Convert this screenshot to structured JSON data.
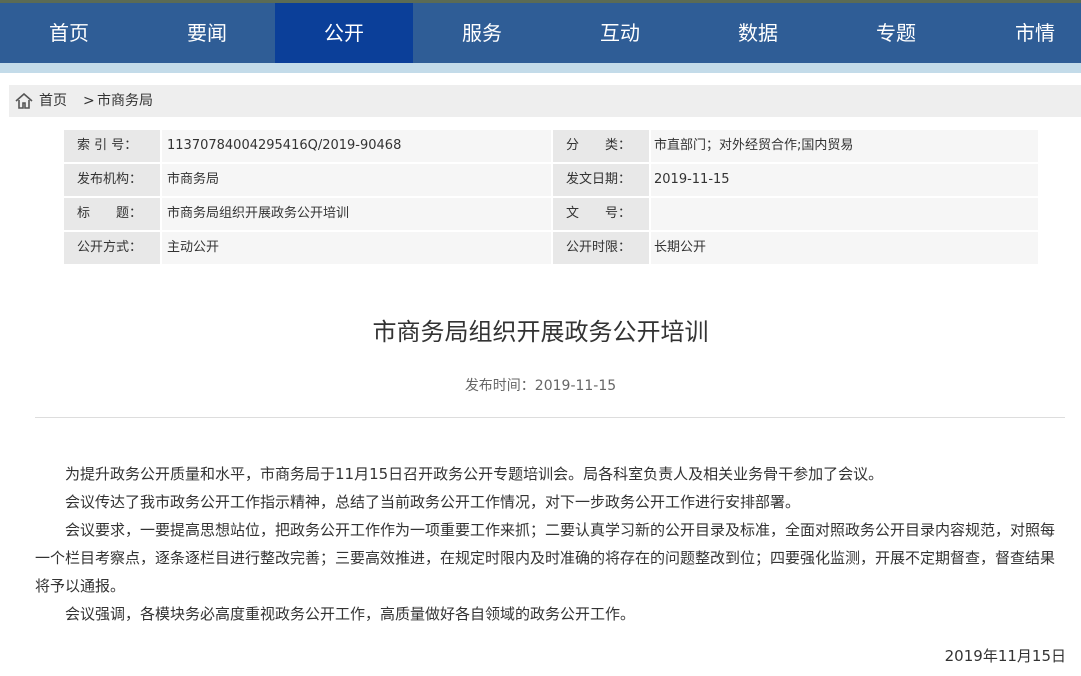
{
  "nav": {
    "items": [
      {
        "label": "首页"
      },
      {
        "label": "要闻"
      },
      {
        "label": "公开"
      },
      {
        "label": "服务"
      },
      {
        "label": "互动"
      },
      {
        "label": "数据"
      },
      {
        "label": "专题"
      },
      {
        "label": "市情"
      }
    ],
    "active": "公开"
  },
  "breadcrumb": {
    "home": "首页",
    "separator": ">",
    "current": "市商务局"
  },
  "meta": {
    "index_label": "索 引 号：",
    "index_value": "11370784004295416Q/2019-90468",
    "category_label": "分　　类：",
    "category_value": "市直部门；对外经贸合作;国内贸易",
    "org_label": "发布机构：",
    "org_value": "市商务局",
    "date_label": "发文日期：",
    "date_value": "2019-11-15",
    "title_label": "标　　题：",
    "title_value": "市商务局组织开展政务公开培训",
    "doc_label": "文　　号：",
    "doc_value": "",
    "mode_label": "公开方式：",
    "mode_value": "主动公开",
    "period_label": "公开时限：",
    "period_value": "长期公开"
  },
  "article": {
    "title": "市商务局组织开展政务公开培训",
    "pubtime": "发布时间：2019-11-15",
    "paragraphs": [
      "为提升政务公开质量和水平，市商务局于11月15日召开政务公开专题培训会。局各科室负责人及相关业务骨干参加了会议。",
      "会议传达了我市政务公开工作指示精神，总结了当前政务公开工作情况，对下一步政务公开工作进行安排部署。",
      "会议要求，一要提高思想站位，把政务公开工作作为一项重要工作来抓；二要认真学习新的公开目录及标准，全面对照政务公开目录内容规范，对照每一个栏目考察点，逐条逐栏目进行整改完善；三要高效推进，在规定时限内及时准确的将存在的问题整改到位；四要强化监测，开展不定期督查，督查结果将予以通报。",
      "会议强调，各模块务必高度重视政务公开工作，高质量做好各自领域的政务公开工作。"
    ],
    "sign_date": "2019年11月15日"
  },
  "colors": {
    "nav_bg": "#2f5d96",
    "nav_active": "#0b3f99",
    "strip": "#c3dbe9"
  }
}
